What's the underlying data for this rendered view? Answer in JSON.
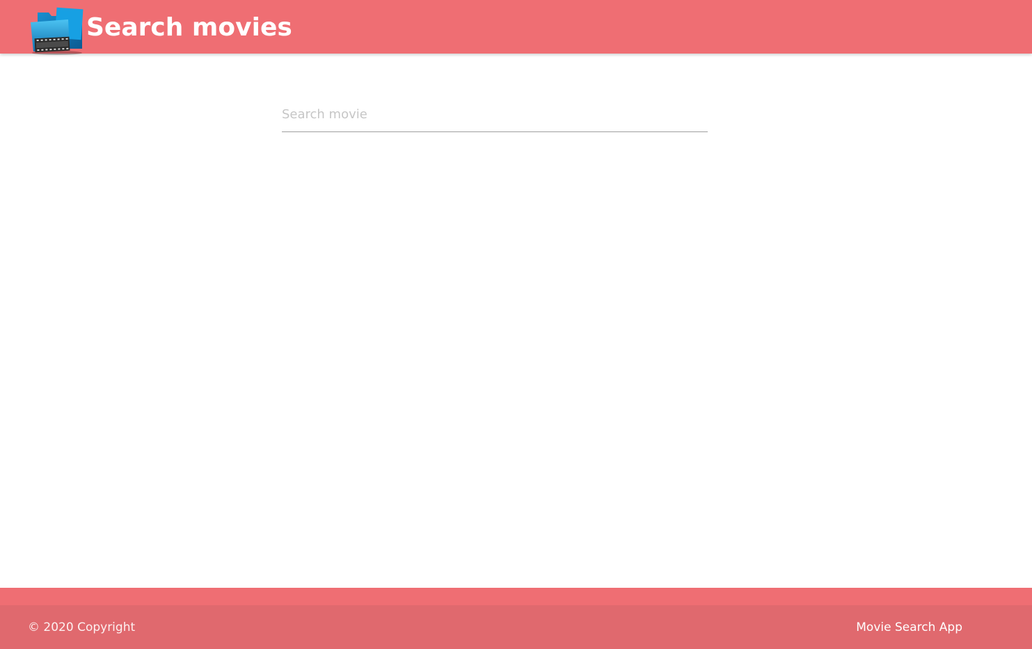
{
  "header": {
    "logo_icon": "movie-folder-icon",
    "title": "Search movies",
    "background_color": "#ef6e73",
    "logo_color": "#1e9ad6"
  },
  "search": {
    "placeholder": "Search movie",
    "value": ""
  },
  "footer": {
    "copyright": "© 2020 Copyright",
    "link_label": "Movie Search App",
    "background_color": "#ef6e73",
    "copyright_bar_color": "#e0696e"
  }
}
